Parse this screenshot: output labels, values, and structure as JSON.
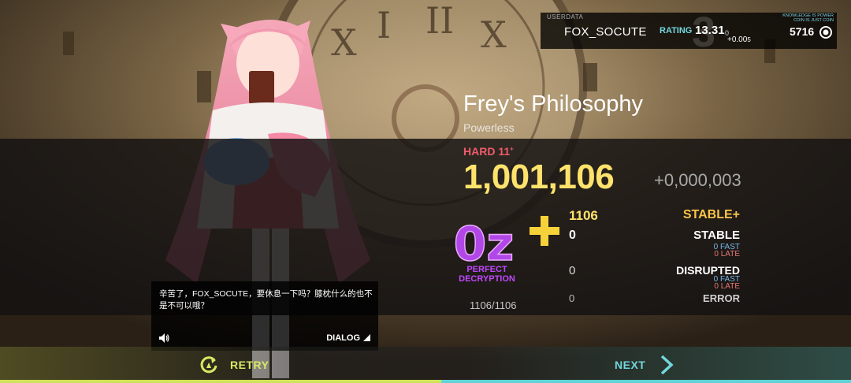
{
  "userdata": {
    "label": "USERDATA",
    "name": "FOX_SOCUTE",
    "rank": "3",
    "rating_label": "RATING",
    "rating_value": "13.31",
    "rating_suffix": "0",
    "rating_delta": "+0.00",
    "rating_delta_small": "5",
    "note": "KNOWLEDGE IS POWER COIN IS JUST COIN",
    "coins": "5716"
  },
  "song": {
    "title": "Frey's Philosophy",
    "artist": "Powerless"
  },
  "result": {
    "difficulty": "HARD 11",
    "difficulty_mark": "+",
    "score": "1,001,106",
    "score_delta": "+0,000,003",
    "grade": "0z",
    "grade_plus": "+",
    "grade_label_line1": "PERFECT",
    "grade_label_line2": "DECRYPTION",
    "total": "1106/1106",
    "counts": {
      "stable_plus": "1106",
      "stable": "0",
      "disrupted": "0",
      "error": "0"
    },
    "labels": {
      "stable_plus": "STABLE+",
      "stable": "STABLE",
      "disrupted": "DISRUPTED",
      "error": "ERROR"
    },
    "stable_fast": "0 FAST",
    "stable_late": "0 LATE",
    "disrupted_fast": "0 FAST",
    "disrupted_late": "0 LATE"
  },
  "dialog": {
    "text": "辛苦了，FOX_SOCUTE，要休息一下吗？膝枕什么的也不是不可以哦？",
    "button": "DIALOG"
  },
  "nav": {
    "retry": "RETRY",
    "next": "NEXT"
  },
  "colors": {
    "score": "#fde36c",
    "difficulty": "#ef5c6b",
    "grade": "#b247e8",
    "retry": "#d8ea63",
    "next": "#73d8dc"
  },
  "icons": {
    "retry": "retry-arrow-icon",
    "next": "chevron-right-icon",
    "speaker": "speaker-icon",
    "coin": "coin-icon",
    "dialog": "triangle-icon"
  }
}
